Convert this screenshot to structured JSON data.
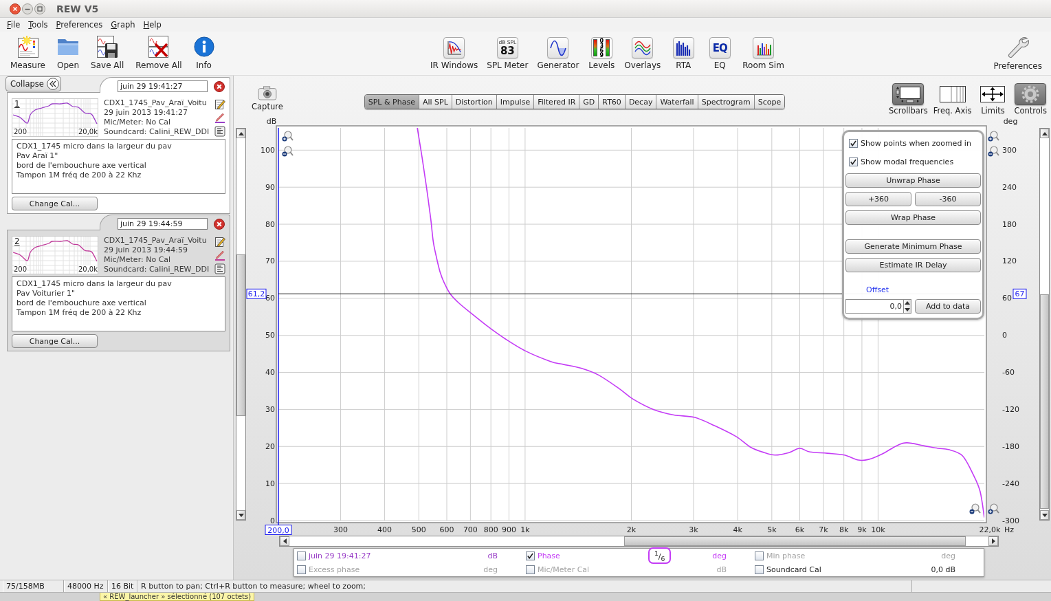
{
  "window": {
    "title": "REW V5"
  },
  "menu": [
    "File",
    "Tools",
    "Preferences",
    "Graph",
    "Help"
  ],
  "toolbar": {
    "main": [
      {
        "label": "Measure"
      },
      {
        "label": "Open"
      },
      {
        "label": "Save All"
      },
      {
        "label": "Remove All"
      },
      {
        "label": "Info"
      }
    ],
    "tools": [
      {
        "label": "IR Windows"
      },
      {
        "label": "SPL Meter",
        "icon_text": [
          "dB SPL",
          "83"
        ]
      },
      {
        "label": "Generator"
      },
      {
        "label": "Levels",
        "icon_text": [
          "0369"
        ]
      },
      {
        "label": "Overlays"
      },
      {
        "label": "RTA"
      },
      {
        "label": "EQ",
        "icon_text": [
          "EQ"
        ]
      },
      {
        "label": "Room Sim"
      }
    ],
    "settings": [
      {
        "label": "Preferences"
      }
    ]
  },
  "measurements_panel": {
    "collapse_button": "Collapse",
    "measurements": [
      {
        "name": "juin 29 19:41:27",
        "selected": true,
        "color": "#9a3fc8",
        "number": "1",
        "thumbnail_start": "200",
        "thumbnail_end": "20,0k",
        "title": "CDX1_1745_Pav_Araï_Voitu",
        "date": "29 juin 2013 19:41:27",
        "mic_meter": "Mic/Meter: No Cal",
        "soundcard": "Soundcard: Calini_REW_DDI",
        "notes": "CDX1_1745 micro dans la largeur du pav\nPav Araï 1\"\nbord de l'embouchure axe vertical\nTampon 1M fréq de 200 à 22 Khz",
        "change_cal_button": "Change Cal..."
      },
      {
        "name": "juin 29 19:44:59",
        "selected": false,
        "color": "#c0399a",
        "number": "2",
        "thumbnail_start": "200",
        "thumbnail_end": "20,0k",
        "title": "CDX1_1745_Pav_Araï_Voitu",
        "date": "29 juin 2013 19:44:59",
        "mic_meter": "Mic/Meter: No Cal",
        "soundcard": "Soundcard: Calini_REW_DDI",
        "notes": "CDX1_1745 micro dans la largeur du pav\nPav Voiturier 1\"\nbord de l'embouchure axe vertical\nTampon 1M fréq de 200 à 22 Khz",
        "change_cal_button": "Change Cal..."
      }
    ]
  },
  "graph": {
    "capture_button": "Capture",
    "tabs": [
      {
        "label": "SPL & Phase",
        "selected": true
      },
      {
        "label": "All SPL",
        "selected": false
      },
      {
        "label": "Distortion",
        "selected": false
      },
      {
        "label": "Impulse",
        "selected": false
      },
      {
        "label": "Filtered IR",
        "selected": false
      },
      {
        "label": "GD",
        "selected": false
      },
      {
        "label": "RT60",
        "selected": false
      },
      {
        "label": "Decay",
        "selected": false
      },
      {
        "label": "Waterfall",
        "selected": false
      },
      {
        "label": "Spectrogram",
        "selected": false
      },
      {
        "label": "Scope",
        "selected": false
      }
    ],
    "view_toggles": [
      {
        "label": "Scrollbars",
        "on": true
      },
      {
        "label": "Freq. Axis",
        "on": false
      },
      {
        "label": "Limits",
        "on": false
      },
      {
        "label": "Controls",
        "on": true
      }
    ],
    "chart_data": {
      "type": "line",
      "grid": true,
      "log": "x",
      "xlabel": "Hz",
      "ylabel": "dB",
      "y2label": "deg",
      "xlim": [
        200,
        20000
      ],
      "ylim": [
        0,
        106
      ],
      "y2lim": [
        -300,
        336
      ],
      "xticks": [
        300,
        400,
        500,
        600,
        700,
        800,
        900,
        {
          "value": 1000,
          "label": "1k"
        },
        {
          "value": 2000,
          "label": "2k"
        },
        {
          "value": 3000,
          "label": "3k"
        },
        {
          "value": 4000,
          "label": "4k"
        },
        {
          "value": 5000,
          "label": "5k"
        },
        {
          "value": 6000,
          "label": "6k"
        },
        {
          "value": 7000,
          "label": "7k"
        },
        {
          "value": 8000,
          "label": "8k"
        },
        {
          "value": 9000,
          "label": "9k"
        },
        {
          "value": 10000,
          "label": "10k"
        }
      ],
      "yticks": [
        0,
        10,
        20,
        30,
        40,
        50,
        60,
        70,
        80,
        90,
        100
      ],
      "y2ticks": [
        -300,
        -240,
        -180,
        -120,
        -60,
        0,
        60,
        120,
        180,
        240,
        300
      ],
      "x": [
        495,
        510,
        525,
        540,
        549,
        560,
        574,
        590,
        614,
        650,
        703,
        786,
        880,
        1000,
        1177,
        1283,
        1436,
        1611,
        1844,
        2018,
        2309,
        2640,
        3026,
        3459,
        3962,
        4348,
        4761,
        5104,
        5592,
        5993,
        6418,
        7179,
        8028,
        8794,
        9397,
        10292,
        11270,
        12066,
        13508,
        14780,
        15830,
        17340,
        18580,
        19460,
        20000
      ],
      "series": [
        {
          "color": "#c43cf6",
          "axis": "y2",
          "values": [
            336,
            290,
            242,
            190,
            153,
            128,
            103,
            85,
            67,
            52,
            36,
            14,
            -6,
            -25,
            -42,
            -47,
            -53,
            -64,
            -86,
            -103,
            -120,
            -129,
            -133,
            -147,
            -164,
            -181,
            -190,
            -194,
            -190,
            -183,
            -189,
            -191,
            -194,
            -202,
            -201,
            -192,
            -179,
            -174,
            -179,
            -183,
            -185,
            -195,
            -225,
            -253,
            -295
          ]
        }
      ],
      "ref_lines": [
        {
          "axis": "x",
          "value": 200,
          "label": "200,0"
        },
        {
          "axis": "y",
          "value": 61.2,
          "label": "61,2"
        }
      ]
    },
    "cursor_right_readout": "67",
    "x_end_label": "22,0k",
    "controls_panel": {
      "options": [
        {
          "label": "Show points when zoomed in",
          "checked": true
        },
        {
          "label": "Show modal frequencies",
          "checked": true
        }
      ],
      "unwrap_button": "Unwrap Phase",
      "shift_buttons": [
        "+360",
        "-360"
      ],
      "wrap_button": "Wrap Phase",
      "action_buttons": [
        "Generate Minimum Phase",
        "Estimate IR Delay"
      ],
      "offset_label": "Offset",
      "offset_value": "0,0",
      "add_button": "Add to data"
    },
    "legend": [
      {
        "label": "juin 29 19:41:27",
        "unit": "dB",
        "checked": false,
        "disabled": false,
        "color": "#9a3fc8"
      },
      {
        "label": "Phase",
        "unit": "deg",
        "checked": true,
        "disabled": false,
        "color": "#c43cf6",
        "smoothing": "$^{1}$/$_{6}$"
      },
      {
        "label": "Min phase",
        "unit": "deg",
        "checked": false,
        "disabled": true
      },
      {
        "label": "Excess phase",
        "unit": "deg",
        "checked": false,
        "disabled": true
      },
      {
        "label": "Mic/Meter Cal",
        "unit": "dB",
        "checked": false,
        "disabled": true
      },
      {
        "label": "Soundcard Cal",
        "reading": "0,0 dB",
        "checked": false,
        "disabled": false
      }
    ]
  },
  "status_bar": {
    "memory": "75/158MB",
    "sample_rate": "48000 Hz",
    "bit_depth": "16 Bit",
    "hint": "R button to pan; Ctrl+R button to measure; wheel to zoom;"
  },
  "desktop": {
    "tooltip": "« REW_launcher » sélectionné (107 octets)"
  }
}
